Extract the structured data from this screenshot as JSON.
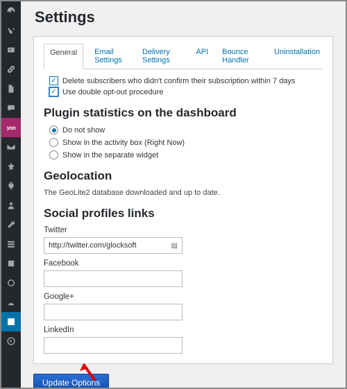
{
  "pageTitle": "Settings",
  "tabs": [
    {
      "label": "General",
      "active": true
    },
    {
      "label": "Email Settings"
    },
    {
      "label": "Delivery Settings"
    },
    {
      "label": "API"
    },
    {
      "label": "Bounce Handler"
    },
    {
      "label": "Uninstallation"
    }
  ],
  "checkboxes": {
    "deleteUnconfirmed": "Delete subscribers who didn't confirm their subscription within 7 days",
    "doubleOptOut": "Use double opt-out procedure"
  },
  "sections": {
    "stats": {
      "heading": "Plugin statistics on the dashboard",
      "options": [
        "Do not show",
        "Show in the activity box (Right Now)",
        "Show in the separate widget"
      ],
      "selected": 0
    },
    "geo": {
      "heading": "Geolocation",
      "text": "The GeoLite2 database downloaded and up to date."
    },
    "social": {
      "heading": "Social profiles links",
      "fields": {
        "twitter": {
          "label": "Twitter",
          "value": "http://twitter.com/glocksoft"
        },
        "facebook": {
          "label": "Facebook",
          "value": ""
        },
        "google": {
          "label": "Google+",
          "value": ""
        },
        "linkedin": {
          "label": "LinkedIn",
          "value": ""
        }
      }
    }
  },
  "submitLabel": "Update Options"
}
